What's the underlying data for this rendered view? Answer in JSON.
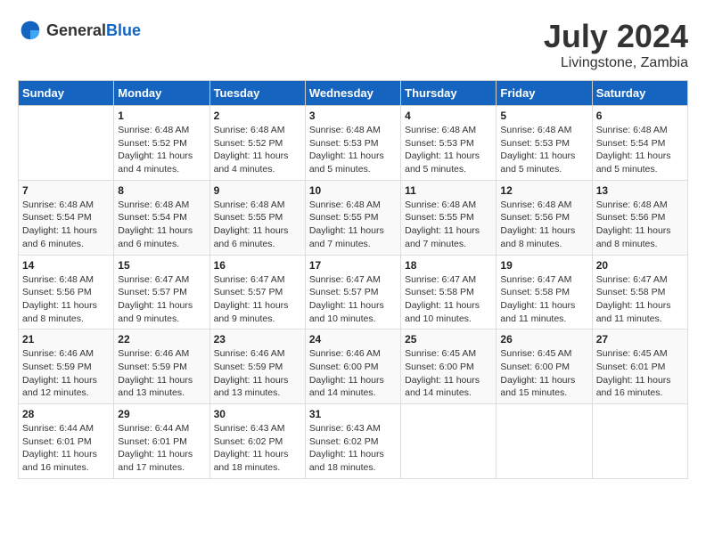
{
  "header": {
    "logo_general": "General",
    "logo_blue": "Blue",
    "month": "July 2024",
    "location": "Livingstone, Zambia"
  },
  "days_of_week": [
    "Sunday",
    "Monday",
    "Tuesday",
    "Wednesday",
    "Thursday",
    "Friday",
    "Saturday"
  ],
  "weeks": [
    [
      {
        "day": "",
        "info": ""
      },
      {
        "day": "1",
        "info": "Sunrise: 6:48 AM\nSunset: 5:52 PM\nDaylight: 11 hours\nand 4 minutes."
      },
      {
        "day": "2",
        "info": "Sunrise: 6:48 AM\nSunset: 5:52 PM\nDaylight: 11 hours\nand 4 minutes."
      },
      {
        "day": "3",
        "info": "Sunrise: 6:48 AM\nSunset: 5:53 PM\nDaylight: 11 hours\nand 5 minutes."
      },
      {
        "day": "4",
        "info": "Sunrise: 6:48 AM\nSunset: 5:53 PM\nDaylight: 11 hours\nand 5 minutes."
      },
      {
        "day": "5",
        "info": "Sunrise: 6:48 AM\nSunset: 5:53 PM\nDaylight: 11 hours\nand 5 minutes."
      },
      {
        "day": "6",
        "info": "Sunrise: 6:48 AM\nSunset: 5:54 PM\nDaylight: 11 hours\nand 5 minutes."
      }
    ],
    [
      {
        "day": "7",
        "info": "Sunrise: 6:48 AM\nSunset: 5:54 PM\nDaylight: 11 hours\nand 6 minutes."
      },
      {
        "day": "8",
        "info": "Sunrise: 6:48 AM\nSunset: 5:54 PM\nDaylight: 11 hours\nand 6 minutes."
      },
      {
        "day": "9",
        "info": "Sunrise: 6:48 AM\nSunset: 5:55 PM\nDaylight: 11 hours\nand 6 minutes."
      },
      {
        "day": "10",
        "info": "Sunrise: 6:48 AM\nSunset: 5:55 PM\nDaylight: 11 hours\nand 7 minutes."
      },
      {
        "day": "11",
        "info": "Sunrise: 6:48 AM\nSunset: 5:55 PM\nDaylight: 11 hours\nand 7 minutes."
      },
      {
        "day": "12",
        "info": "Sunrise: 6:48 AM\nSunset: 5:56 PM\nDaylight: 11 hours\nand 8 minutes."
      },
      {
        "day": "13",
        "info": "Sunrise: 6:48 AM\nSunset: 5:56 PM\nDaylight: 11 hours\nand 8 minutes."
      }
    ],
    [
      {
        "day": "14",
        "info": "Sunrise: 6:48 AM\nSunset: 5:56 PM\nDaylight: 11 hours\nand 8 minutes."
      },
      {
        "day": "15",
        "info": "Sunrise: 6:47 AM\nSunset: 5:57 PM\nDaylight: 11 hours\nand 9 minutes."
      },
      {
        "day": "16",
        "info": "Sunrise: 6:47 AM\nSunset: 5:57 PM\nDaylight: 11 hours\nand 9 minutes."
      },
      {
        "day": "17",
        "info": "Sunrise: 6:47 AM\nSunset: 5:57 PM\nDaylight: 11 hours\nand 10 minutes."
      },
      {
        "day": "18",
        "info": "Sunrise: 6:47 AM\nSunset: 5:58 PM\nDaylight: 11 hours\nand 10 minutes."
      },
      {
        "day": "19",
        "info": "Sunrise: 6:47 AM\nSunset: 5:58 PM\nDaylight: 11 hours\nand 11 minutes."
      },
      {
        "day": "20",
        "info": "Sunrise: 6:47 AM\nSunset: 5:58 PM\nDaylight: 11 hours\nand 11 minutes."
      }
    ],
    [
      {
        "day": "21",
        "info": "Sunrise: 6:46 AM\nSunset: 5:59 PM\nDaylight: 11 hours\nand 12 minutes."
      },
      {
        "day": "22",
        "info": "Sunrise: 6:46 AM\nSunset: 5:59 PM\nDaylight: 11 hours\nand 13 minutes."
      },
      {
        "day": "23",
        "info": "Sunrise: 6:46 AM\nSunset: 5:59 PM\nDaylight: 11 hours\nand 13 minutes."
      },
      {
        "day": "24",
        "info": "Sunrise: 6:46 AM\nSunset: 6:00 PM\nDaylight: 11 hours\nand 14 minutes."
      },
      {
        "day": "25",
        "info": "Sunrise: 6:45 AM\nSunset: 6:00 PM\nDaylight: 11 hours\nand 14 minutes."
      },
      {
        "day": "26",
        "info": "Sunrise: 6:45 AM\nSunset: 6:00 PM\nDaylight: 11 hours\nand 15 minutes."
      },
      {
        "day": "27",
        "info": "Sunrise: 6:45 AM\nSunset: 6:01 PM\nDaylight: 11 hours\nand 16 minutes."
      }
    ],
    [
      {
        "day": "28",
        "info": "Sunrise: 6:44 AM\nSunset: 6:01 PM\nDaylight: 11 hours\nand 16 minutes."
      },
      {
        "day": "29",
        "info": "Sunrise: 6:44 AM\nSunset: 6:01 PM\nDaylight: 11 hours\nand 17 minutes."
      },
      {
        "day": "30",
        "info": "Sunrise: 6:43 AM\nSunset: 6:02 PM\nDaylight: 11 hours\nand 18 minutes."
      },
      {
        "day": "31",
        "info": "Sunrise: 6:43 AM\nSunset: 6:02 PM\nDaylight: 11 hours\nand 18 minutes."
      },
      {
        "day": "",
        "info": ""
      },
      {
        "day": "",
        "info": ""
      },
      {
        "day": "",
        "info": ""
      }
    ]
  ]
}
